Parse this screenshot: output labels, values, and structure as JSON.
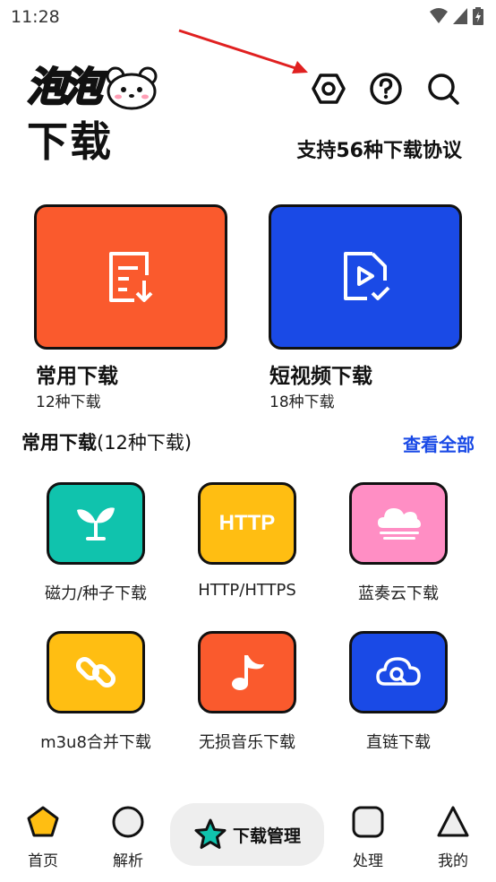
{
  "status_bar": {
    "time": "11:28"
  },
  "logo": {
    "top_text": "泡泡",
    "bottom_text": "下载"
  },
  "header": {
    "protocol_text": "支持56种下载协议"
  },
  "cards": [
    {
      "title": "常用下载",
      "subtitle": "12种下载",
      "color": "#fa5a2d",
      "icon": "document-download-icon"
    },
    {
      "title": "短视频下载",
      "subtitle": "18种下载",
      "color": "#1a4ae6",
      "icon": "video-file-icon"
    }
  ],
  "section": {
    "title_bold": "常用下载",
    "title_rest": "(12种下载)",
    "view_all": "查看全部"
  },
  "tiles": [
    {
      "label": "磁力/种子下载",
      "color": "#10c3ad",
      "icon": "sprout-icon"
    },
    {
      "label": "HTTP/HTTPS",
      "color": "#ffbe12",
      "icon": "http-icon",
      "icon_text": "HTTP"
    },
    {
      "label": "蓝奏云下载",
      "color": "#ff8ec4",
      "icon": "cloud-icon"
    },
    {
      "label": "m3u8合并下载",
      "color": "#ffbe12",
      "icon": "link-icon"
    },
    {
      "label": "无损音乐下载",
      "color": "#fa5a2d",
      "icon": "music-note-icon"
    },
    {
      "label": "直链下载",
      "color": "#1a4ae6",
      "icon": "cloud-search-icon"
    }
  ],
  "bottom_nav": {
    "home": "首页",
    "parse": "解析",
    "manage": "下载管理",
    "process": "处理",
    "mine": "我的"
  }
}
